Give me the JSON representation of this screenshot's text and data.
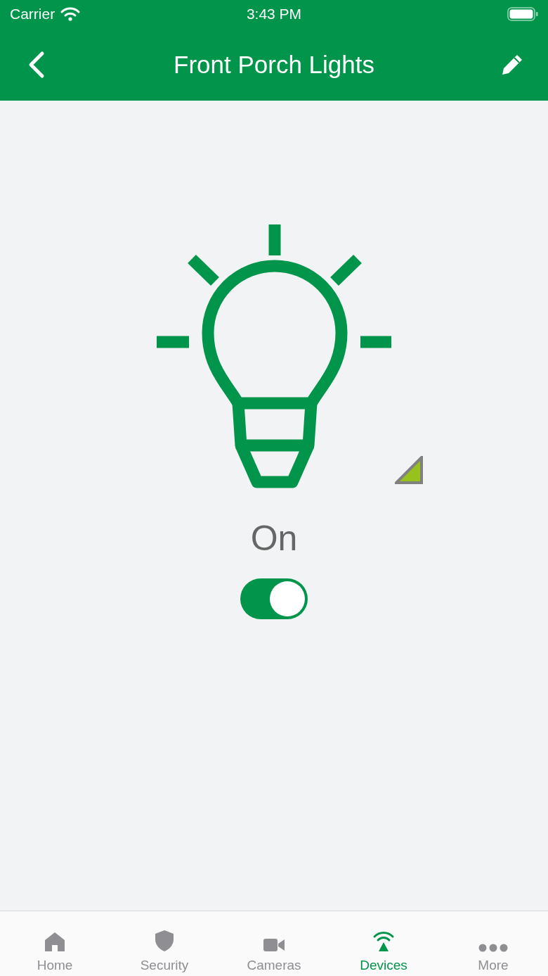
{
  "status_bar": {
    "carrier": "Carrier",
    "time": "3:43 PM"
  },
  "nav_bar": {
    "title": "Front Porch Lights"
  },
  "device": {
    "state_label": "On",
    "on": true
  },
  "tab_bar": [
    {
      "kind": "home",
      "label": "Home",
      "selected": false
    },
    {
      "kind": "shield",
      "label": "Security",
      "selected": false
    },
    {
      "kind": "camera",
      "label": "Cameras",
      "selected": false
    },
    {
      "kind": "signal",
      "label": "Devices",
      "selected": true
    },
    {
      "kind": "more",
      "label": "More",
      "selected": false
    }
  ]
}
